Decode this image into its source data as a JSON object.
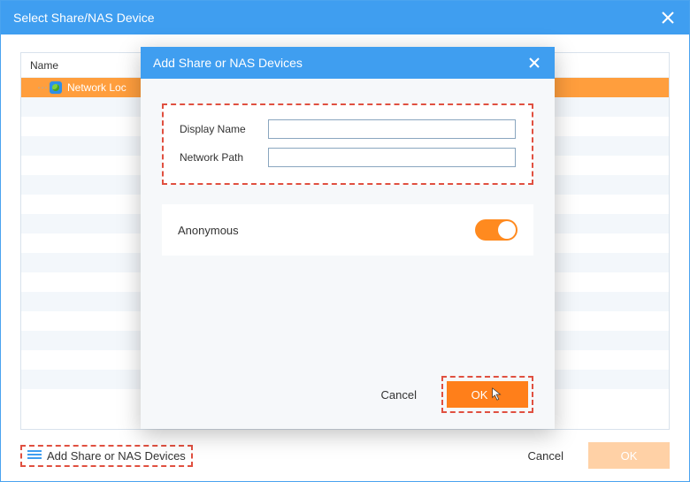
{
  "main": {
    "title": "Select Share/NAS Device",
    "grid": {
      "header": "Name",
      "rows": [
        {
          "label": "Network Loc"
        }
      ]
    },
    "addDeviceText": "Add Share or NAS Devices",
    "cancel": "Cancel",
    "ok": "OK"
  },
  "modal": {
    "title": "Add Share or NAS Devices",
    "fields": {
      "displayName": {
        "label": "Display Name",
        "value": ""
      },
      "networkPath": {
        "label": "Network Path",
        "value": ""
      }
    },
    "anonymousLabel": "Anonymous",
    "anonymousOn": true,
    "cancel": "Cancel",
    "ok": "OK"
  },
  "colors": {
    "accent": "#3f9ef0",
    "orange": "#ff7f1a",
    "highlightDash": "#e05040"
  }
}
